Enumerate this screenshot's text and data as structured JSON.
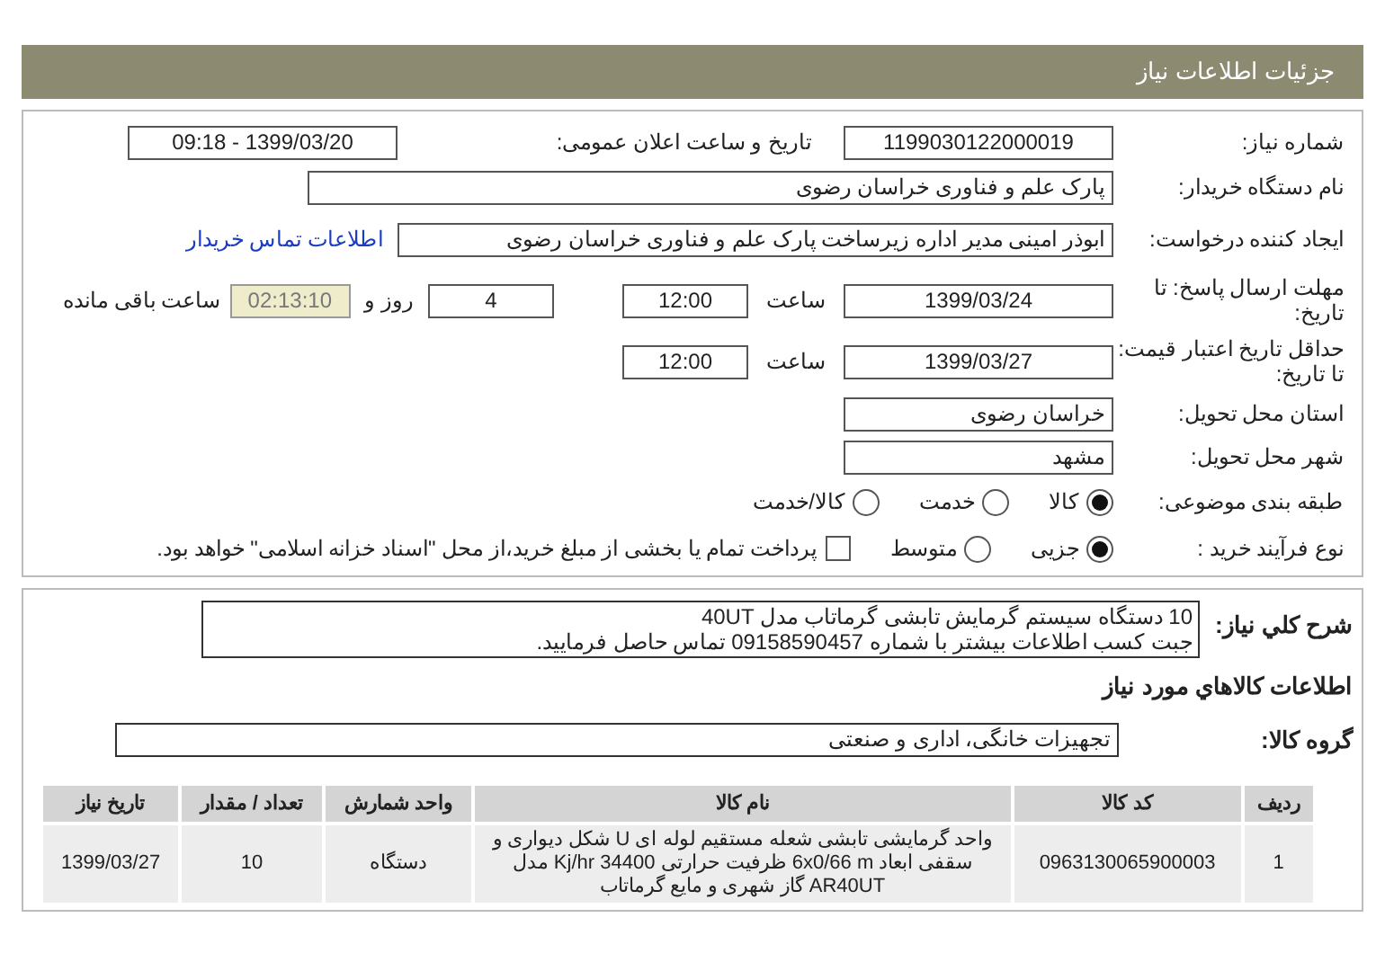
{
  "header": {
    "title": "جزئیات اطلاعات نیاز"
  },
  "need_number": {
    "label": "شماره نیاز:",
    "value": "1199030122000019"
  },
  "announce": {
    "label": "تاریخ و ساعت اعلان عمومی:",
    "value": "1399/03/20 - 09:18"
  },
  "buyer": {
    "label": "نام دستگاه خریدار:",
    "value": "پارک علم و فناوری خراسان رضوی"
  },
  "creator": {
    "label": "ایجاد کننده درخواست:",
    "value": "ابوذر امینی مدیر اداره زیرساخت پارک علم و فناوری خراسان رضوی",
    "link": "اطلاعات تماس خریدار"
  },
  "deadline": {
    "label": "مهلت ارسال پاسخ: تا تاریخ:",
    "date": "1399/03/24",
    "time_label": "ساعت",
    "time": "12:00",
    "days": "4",
    "days_label": "روز و",
    "remaining": "02:13:10",
    "remaining_label": "ساعت باقی مانده"
  },
  "validity": {
    "label": "حداقل تاریخ اعتبار قیمت: تا تاریخ:",
    "date": "1399/03/27",
    "time_label": "ساعت",
    "time": "12:00"
  },
  "province": {
    "label": "استان محل تحویل:",
    "value": "خراسان رضوی"
  },
  "city": {
    "label": "شهر محل تحویل:",
    "value": "مشهد"
  },
  "category": {
    "label": "طبقه بندی موضوعی:",
    "options": [
      {
        "label": "کالا",
        "selected": true
      },
      {
        "label": "خدمت",
        "selected": false
      },
      {
        "label": "کالا/خدمت",
        "selected": false
      }
    ]
  },
  "process": {
    "label": "نوع فرآیند خرید :",
    "options": [
      {
        "label": "جزیی",
        "selected": true
      },
      {
        "label": "متوسط",
        "selected": false
      }
    ],
    "payment": {
      "label": "پرداخت تمام یا بخشی از مبلغ خرید،از محل \"اسناد خزانه اسلامی\" خواهد بود.",
      "checked": false
    }
  },
  "description": {
    "label": "شرح كلي نياز:",
    "lines": [
      "10 دستگاه سیستم گرمایش تابشی گرماتاب مدل 40UT",
      "جبت کسب اطلاعات بیشتر با شماره 09158590457 تماس حاصل فرمایید."
    ]
  },
  "goods_heading": "اطلاعات كالاهاي مورد نياز",
  "goods_group": {
    "label": "گروه کالا:",
    "value": "تجهیزات خانگی، اداری و صنعتی"
  },
  "table": {
    "columns": [
      "ردیف",
      "کد کالا",
      "نام کالا",
      "واحد شمارش",
      "تعداد / مقدار",
      "تاریخ نیاز"
    ],
    "rows": [
      [
        "1",
        "0963130065900003",
        "واحد گرمایشی تابشی شعله مستقیم لوله ای U شکل دیواری و سقفی ابعاد 6x0/66 m ظرفیت حرارتی 34400 Kj/hr مدل AR40UT گاز شهری و مایع گرماتاب",
        "دستگاه",
        "10",
        "1399/03/27"
      ]
    ]
  }
}
